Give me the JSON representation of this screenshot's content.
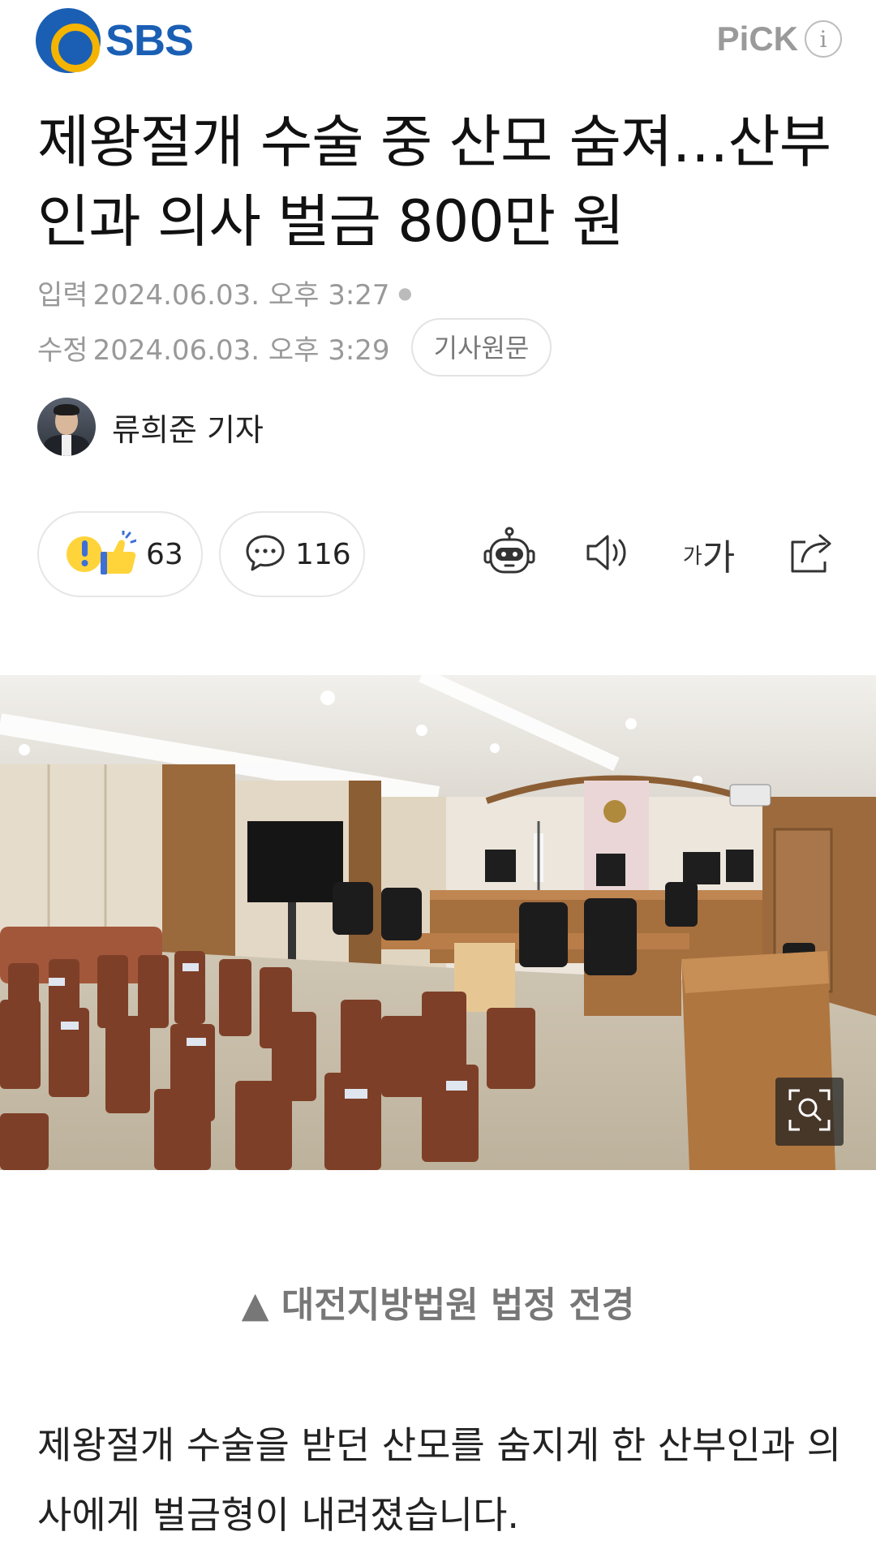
{
  "header": {
    "logo_text": "SBS",
    "pick_label": "PiCK",
    "pick_info": "i",
    "brand_blue": "#1a5fb4",
    "brand_yellow": "#f4b400"
  },
  "article": {
    "title": "제왕절개 수술 중 산모 숨져…산부인과 의사 벌금 800만 원",
    "published_label": "입력",
    "published": "2024.06.03. 오후 3:27",
    "modified_label": "수정",
    "modified": "2024.06.03. 오후 3:29",
    "original_button": "기사원문",
    "reporter": "류희준 기자"
  },
  "actions": {
    "reaction_count": "63",
    "comment_count": "116",
    "font_small": "가",
    "font_big": "가",
    "icons": [
      "reaction-icon",
      "comment-icon",
      "robot-icon",
      "speaker-icon",
      "font-size-icon",
      "share-icon",
      "zoom-icon"
    ]
  },
  "photo": {
    "caption": "▲ 대전지방법원 법정 전경"
  },
  "body": {
    "paragraph": "제왕절개 수술을 받던 산모를 숨지게 한 산부인과 의사에게 벌금형이 내려졌습니다."
  }
}
